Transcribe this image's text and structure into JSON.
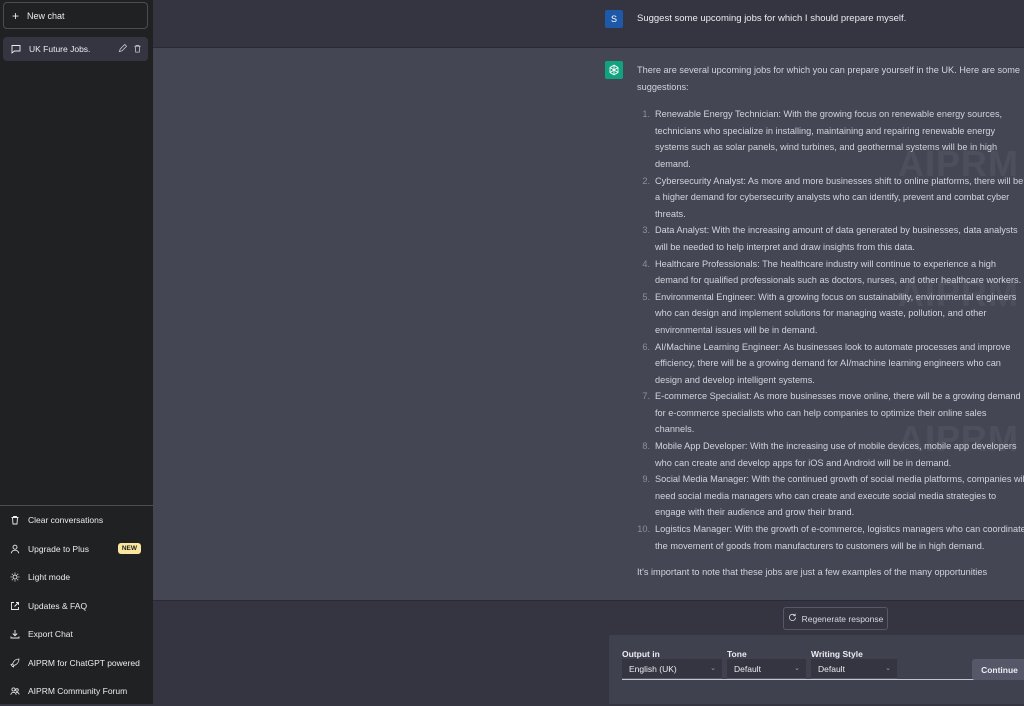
{
  "sidebar": {
    "new_chat": "New chat",
    "conversations": [
      {
        "title": "UK Future Jobs."
      }
    ],
    "bottom_items": [
      {
        "label": "Clear conversations",
        "icon": "trash-icon"
      },
      {
        "label": "Upgrade to Plus",
        "icon": "user-icon",
        "badge": "NEW"
      },
      {
        "label": "Light mode",
        "icon": "sun-icon"
      },
      {
        "label": "Updates & FAQ",
        "icon": "external-link-icon"
      },
      {
        "label": "Export Chat",
        "icon": "download-icon"
      },
      {
        "label": "AIPRM for ChatGPT powered",
        "icon": "rocket-icon"
      },
      {
        "label": "AIPRM Community Forum",
        "icon": "community-icon"
      }
    ]
  },
  "conversation": {
    "user_avatar": "S",
    "user_message": "Suggest some upcoming jobs for which I should prepare myself.",
    "assistant_intro": "There are several upcoming jobs for which you can prepare yourself in the UK. Here are some suggestions:",
    "assistant_list": [
      "Renewable Energy Technician: With the growing focus on renewable energy sources, technicians who specialize in installing, maintaining and repairing renewable energy systems such as solar panels, wind turbines, and geothermal systems will be in high demand.",
      "Cybersecurity Analyst: As more and more businesses shift to online platforms, there will be a higher demand for cybersecurity analysts who can identify, prevent and combat cyber threats.",
      "Data Analyst: With the increasing amount of data generated by businesses, data analysts will be needed to help interpret and draw insights from this data.",
      "Healthcare Professionals: The healthcare industry will continue to experience a high demand for qualified professionals such as doctors, nurses, and other healthcare workers.",
      "Environmental Engineer: With a growing focus on sustainability, environmental engineers who can design and implement solutions for managing waste, pollution, and other environmental issues will be in demand.",
      "AI/Machine Learning Engineer: As businesses look to automate processes and improve efficiency, there will be a growing demand for AI/machine learning engineers who can design and develop intelligent systems.",
      "E-commerce Specialist: As more businesses move online, there will be a growing demand for e-commerce specialists who can help companies to optimize their online sales channels.",
      "Mobile App Developer: With the increasing use of mobile devices, mobile app developers who can create and develop apps for iOS and Android will be in demand.",
      "Social Media Manager: With the continued growth of social media platforms, companies will need social media managers who can create and execute social media strategies to engage with their audience and grow their brand.",
      "Logistics Manager: With the growth of e-commerce, logistics managers who can coordinate the movement of goods from manufacturers to customers will be in high demand."
    ],
    "assistant_outro": "It's important to note that these jobs are just a few examples of the many opportunities",
    "watermark": "AIPRM"
  },
  "controls": {
    "regenerate": "Regenerate response",
    "output_label": "Output in",
    "output_value": "English (UK)",
    "tone_label": "Tone",
    "tone_value": "Default",
    "style_label": "Writing Style",
    "style_value": "Default",
    "continue": "Continue"
  },
  "colors": {
    "sidebar_bg": "#202123",
    "main_bg": "#343541",
    "assistant_bg": "#444654",
    "gpt_green": "#10a37f",
    "user_avatar_blue": "#1e58a8"
  }
}
